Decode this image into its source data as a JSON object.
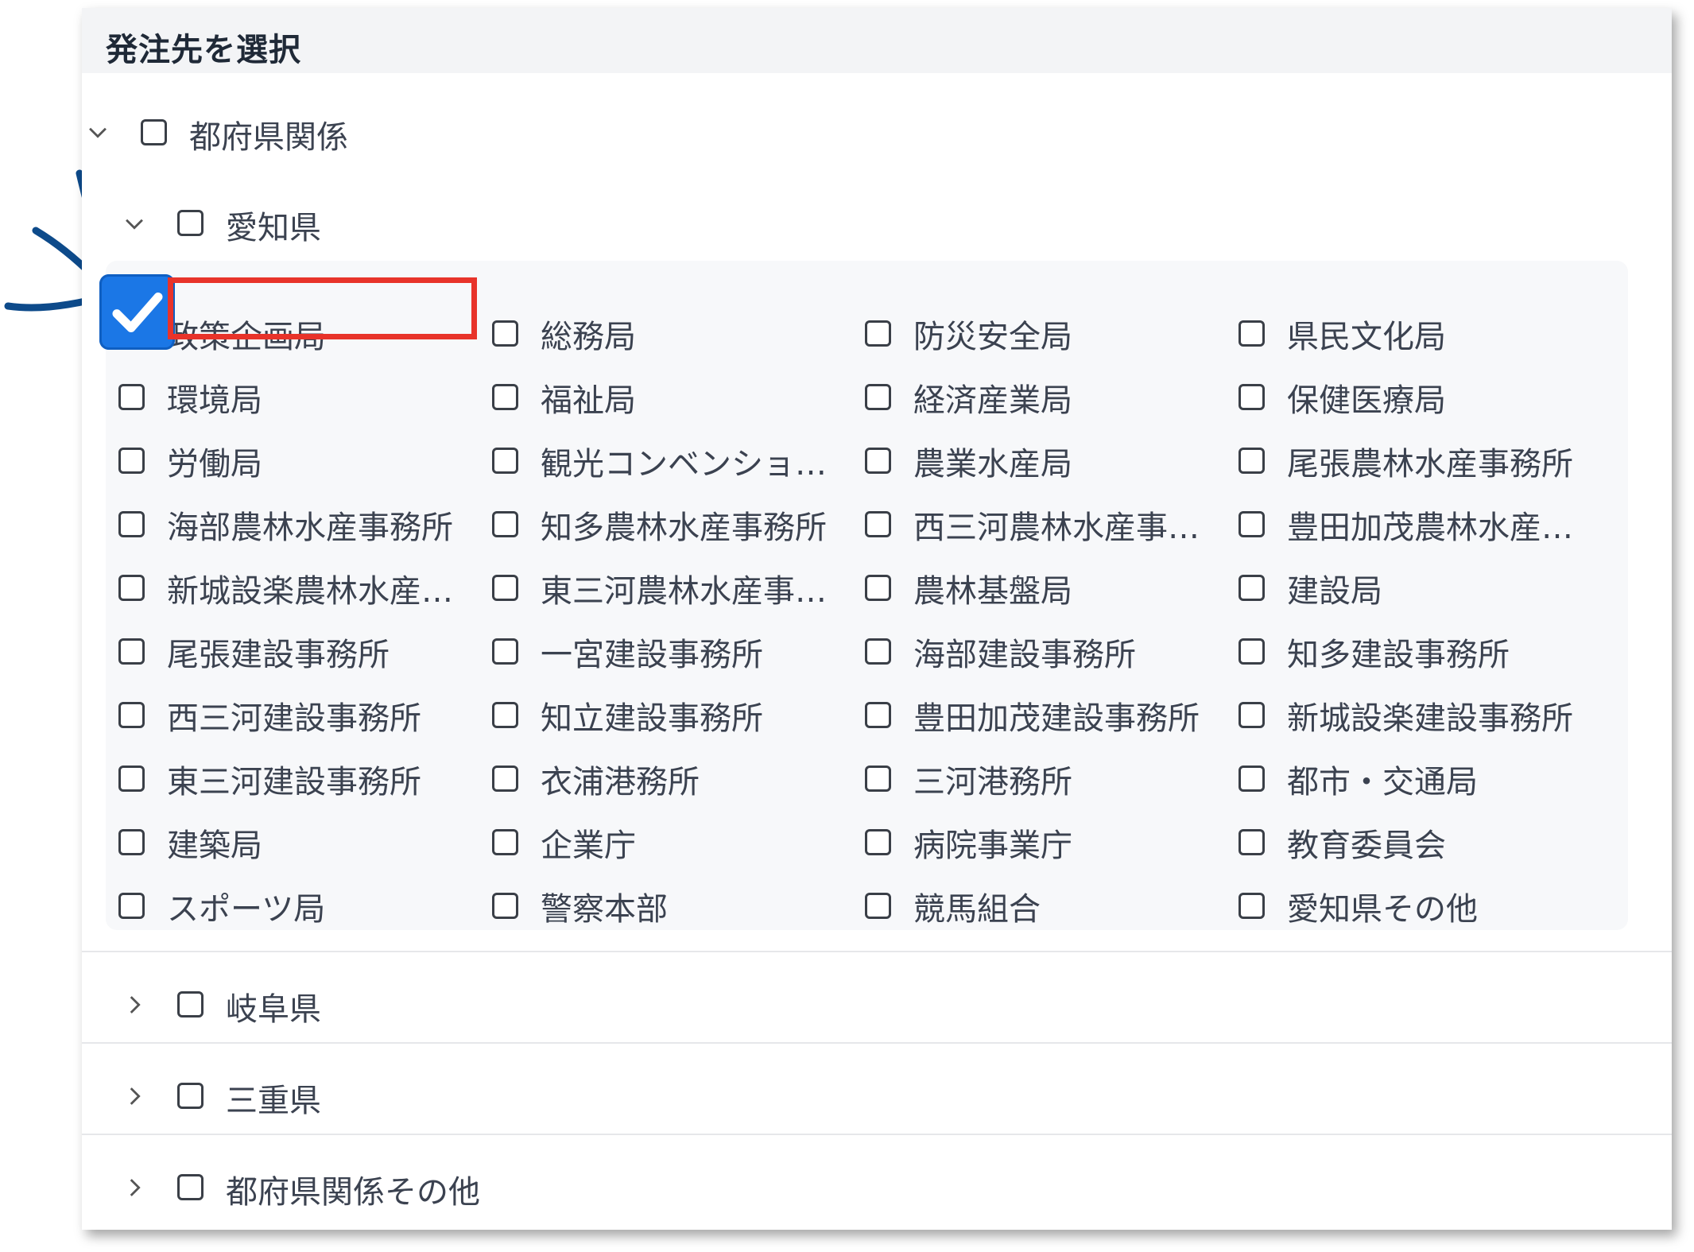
{
  "header": {
    "title": "発注先を選択"
  },
  "tree": {
    "root": {
      "label": "都府県関係"
    },
    "aichi": {
      "label": "愛知県",
      "items": [
        "政策企画局",
        "総務局",
        "防災安全局",
        "県民文化局",
        "環境局",
        "福祉局",
        "経済産業局",
        "保健医療局",
        "労働局",
        "観光コンベンショ…",
        "農業水産局",
        "尾張農林水産事務所",
        "海部農林水産事務所",
        "知多農林水産事務所",
        "西三河農林水産事…",
        "豊田加茂農林水産…",
        "新城設楽農林水産…",
        "東三河農林水産事…",
        "農林基盤局",
        "建設局",
        "尾張建設事務所",
        "一宮建設事務所",
        "海部建設事務所",
        "知多建設事務所",
        "西三河建設事務所",
        "知立建設事務所",
        "豊田加茂建設事務所",
        "新城設楽建設事務所",
        "東三河建設事務所",
        "衣浦港務所",
        "三河港務所",
        "都市・交通局",
        "建築局",
        "企業庁",
        "病院事業庁",
        "教育委員会",
        "スポーツ局",
        "警察本部",
        "競馬組合",
        "愛知県その他"
      ],
      "checked_item": "政策企画局"
    },
    "gifu": {
      "label": "岐阜県"
    },
    "mie": {
      "label": "三重県"
    },
    "other": {
      "label": "都府県関係その他"
    }
  },
  "colors": {
    "accent": "#1b77e6",
    "highlight": "#e8332a",
    "annotation": "#0d4a8a"
  }
}
